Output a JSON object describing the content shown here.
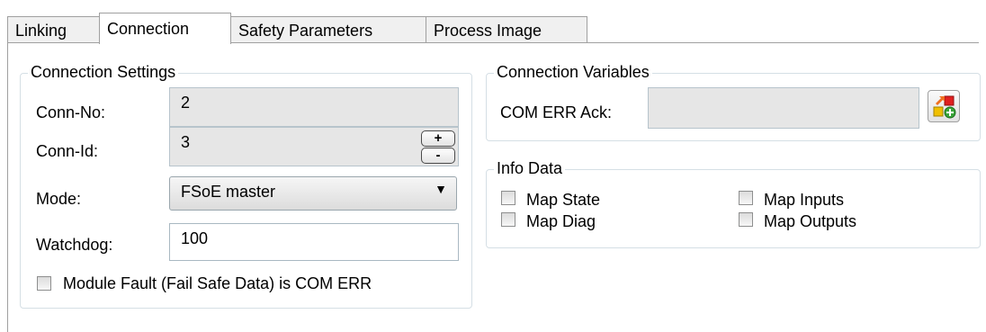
{
  "tabs": [
    "Linking",
    "Connection",
    "Safety Parameters",
    "Process Image"
  ],
  "connection_settings": {
    "title": "Connection Settings",
    "conn_no_label": "Conn-No:",
    "conn_no_value": "2",
    "conn_id_label": "Conn-Id:",
    "conn_id_value": "3",
    "spin_plus": "+",
    "spin_minus": "-",
    "mode_label": "Mode:",
    "mode_value": "FSoE master",
    "watchdog_label": "Watchdog:",
    "watchdog_value": "100",
    "module_fault_label": "Module Fault (Fail Safe Data) is COM ERR"
  },
  "connection_variables": {
    "title": "Connection Variables",
    "com_err_ack_label": "COM ERR Ack:",
    "com_err_ack_value": ""
  },
  "info_data": {
    "title": "Info Data",
    "map_state": "Map State",
    "map_diag": "Map Diag",
    "map_inputs": "Map Inputs",
    "map_outputs": "Map Outputs"
  }
}
